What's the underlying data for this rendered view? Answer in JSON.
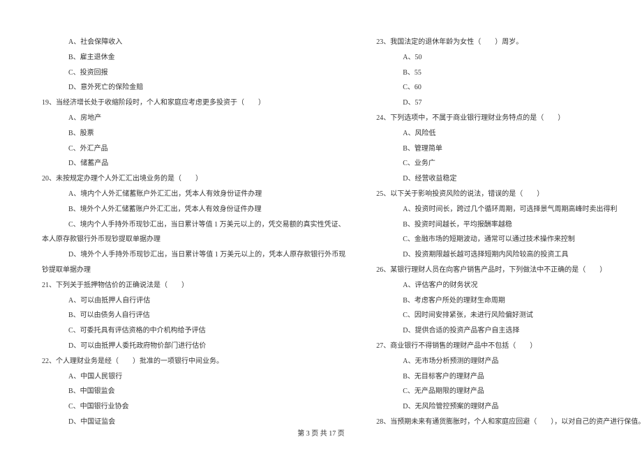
{
  "left_column": [
    {
      "type": "option",
      "text": "A、社会保障收入"
    },
    {
      "type": "option",
      "text": "B、雇主退休金"
    },
    {
      "type": "option",
      "text": "C、投资回报"
    },
    {
      "type": "option",
      "text": "D、意外死亡的保险金赔"
    },
    {
      "type": "question",
      "text": "19、当经济增长处于收缩阶段时，个人和家庭应考虑更多投资于（　　）"
    },
    {
      "type": "option",
      "text": "A、房地产"
    },
    {
      "type": "option",
      "text": "B、股票"
    },
    {
      "type": "option",
      "text": "C、外汇产品"
    },
    {
      "type": "option",
      "text": "D、储蓄产品"
    },
    {
      "type": "question",
      "text": "20、未按规定办理个人外汇汇出境业务的是（　　）"
    },
    {
      "type": "option",
      "text": "A、境内个人外汇储蓄账户外汇汇出，凭本人有效身份证件办理"
    },
    {
      "type": "option",
      "text": "B、境外个人外汇储蓄账户外汇汇出，凭本人有效身份证件办理"
    },
    {
      "type": "option",
      "text": "C、境内个人手持外币现钞汇出，当日累计等值 1 万美元以上的，凭交易额的真实性凭证、"
    },
    {
      "type": "continuation",
      "text": "本人原存款银行外币现钞提取单据办理"
    },
    {
      "type": "option",
      "text": "D、境外个人手持外币现钞汇出，当日累计等值 1 万美元以上的，凭本人原存款银行外币现"
    },
    {
      "type": "continuation",
      "text": "钞提取单据办理"
    },
    {
      "type": "question",
      "text": "21、下列关于抵押物估价的正确说法是（　　）"
    },
    {
      "type": "option",
      "text": "A、可以由抵押人自行评估"
    },
    {
      "type": "option",
      "text": "B、可以由债务人自行评估"
    },
    {
      "type": "option",
      "text": "C、可委托具有评估资格的中介机构给予评估"
    },
    {
      "type": "option",
      "text": "D、可以由抵押人委托政府物价部门进行估价"
    },
    {
      "type": "question",
      "text": "22、个人理财业务是经（　　）批准的一项银行中间业务。"
    },
    {
      "type": "option",
      "text": "A、中国人民银行"
    },
    {
      "type": "option",
      "text": "B、中国银监会"
    },
    {
      "type": "option",
      "text": "C、中国银行业协会"
    },
    {
      "type": "option",
      "text": "D、中国证监会"
    }
  ],
  "right_column": [
    {
      "type": "question",
      "text": "23、我国法定的退休年龄为女性（　　）周岁。"
    },
    {
      "type": "option",
      "text": "A、50"
    },
    {
      "type": "option",
      "text": "B、55"
    },
    {
      "type": "option",
      "text": "C、60"
    },
    {
      "type": "option",
      "text": "D、57"
    },
    {
      "type": "question",
      "text": "24、下列选项中，不属于商业银行理财业务特点的是（　　）"
    },
    {
      "type": "option",
      "text": "A、风险低"
    },
    {
      "type": "option",
      "text": "B、管理简单"
    },
    {
      "type": "option",
      "text": "C、业务广"
    },
    {
      "type": "option",
      "text": "D、经营收益稳定"
    },
    {
      "type": "question",
      "text": "25、以下关于影响投资风险的说法，错误的是（　　）"
    },
    {
      "type": "option",
      "text": "A、投资时间长，跨过几个循环周期，可选择景气周期高峰时卖出得利"
    },
    {
      "type": "option",
      "text": "B、投资时间越长，平均报酬率越稳"
    },
    {
      "type": "option",
      "text": "C、金融市场的短期波动，通常可以通过技术操作来控制"
    },
    {
      "type": "option",
      "text": "D、投资期限越长越可选择短期内风险较高的投资工具"
    },
    {
      "type": "question",
      "text": "26、某银行理财人员在向客户销售产品时，下列做法中不正确的是（　　）"
    },
    {
      "type": "option",
      "text": "A、评估客户的财务状况"
    },
    {
      "type": "option",
      "text": "B、考虑客户所处的理财生命周期"
    },
    {
      "type": "option",
      "text": "C、因时间安排紧张，未进行风险偏好测试"
    },
    {
      "type": "option",
      "text": "D、提供合适的投资产品客户自主选择"
    },
    {
      "type": "question",
      "text": "27、商业银行不得销售的理财产品中不包括（　　）"
    },
    {
      "type": "option",
      "text": "A、无市场分析预测的理财产品"
    },
    {
      "type": "option",
      "text": "B、无目标客户的理财产品"
    },
    {
      "type": "option",
      "text": "C、无产品期限的理财产品"
    },
    {
      "type": "option",
      "text": "D、无风险管控预案的理财产品"
    },
    {
      "type": "question",
      "text": "28、当预期未来有通货膨胀时，个人和家庭应回避（　　），以对自己的资产进行保值。"
    }
  ],
  "footer": "第 3 页 共 17 页"
}
